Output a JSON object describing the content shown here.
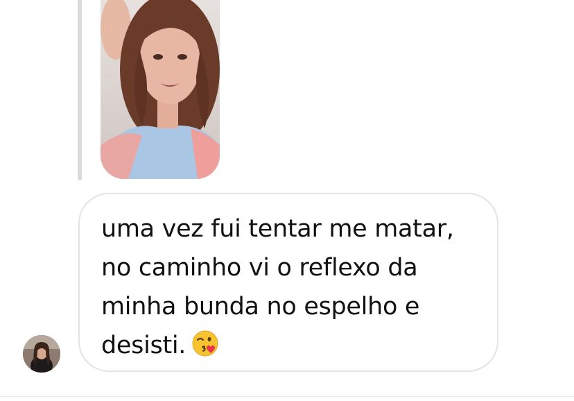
{
  "conversation": {
    "incoming_message": {
      "text": "uma vez fui tentar me matar,\nno caminho vi o reflexo da\nminha bunda no espelho e\ndesisti.",
      "emoji": "face-throwing-a-kiss-emoji"
    },
    "media_message": {
      "kind": "shared-video-thumbnail",
      "icon": "person-selfie-thumbnail"
    },
    "sender": {
      "avatar": "sender-profile-photo"
    }
  },
  "colors": {
    "bubble_border": "#e3e3e3",
    "text": "#111111",
    "reply_line": "#dbdbdb",
    "background": "#ffffff"
  }
}
